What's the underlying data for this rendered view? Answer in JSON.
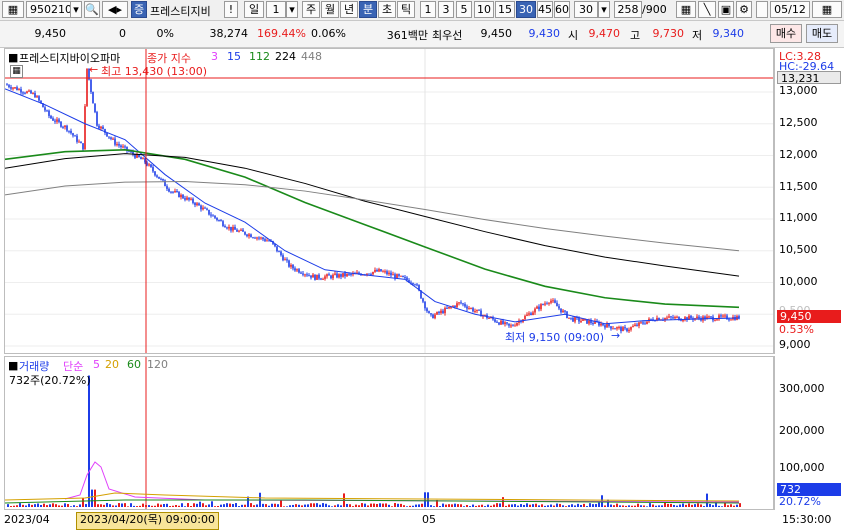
{
  "toolbar": {
    "code": "950210",
    "stock_name": "프레스티지비",
    "tag": "증",
    "warn": "!",
    "period": "일",
    "period_count": "1",
    "periods": [
      "주",
      "월",
      "년",
      "분",
      "초",
      "틱"
    ],
    "active_period": "분",
    "minutes": [
      "1",
      "3",
      "5",
      "10",
      "15",
      "30",
      "45",
      "60"
    ],
    "active_minute": "30",
    "count": "30",
    "page": "258",
    "page_total": "/900",
    "date": "05/12"
  },
  "quote": {
    "price": "9,450",
    "change": "0",
    "change_rate": "0%",
    "volume": "38,274",
    "volume_ratio": "169.44%",
    "turnover": "0.06%",
    "amount": "361백만",
    "best_bid_label": "최우선",
    "best_bid": "9,450",
    "best_ask": "9,430",
    "open_label": "시",
    "open": "9,470",
    "high_label": "고",
    "high": "9,730",
    "low_label": "저",
    "low": "9,340",
    "buy_label": "매수",
    "sell_label": "매도"
  },
  "price_panel": {
    "name": "프레스티지바이오파마",
    "ma_label": "종가 지수",
    "ma_periods": [
      "3",
      "15",
      "112",
      "224",
      "448"
    ],
    "lc": "LC:3.28",
    "hc": "HC:-29.64",
    "high_marker": "최고 13,430 (13:00)",
    "low_marker": "최저 9,150 (09:00)",
    "crosshair_price": "13,231",
    "last_price": "9,450",
    "last_change": "0.53%",
    "y_ticks": [
      "13,000",
      "12,500",
      "12,000",
      "11,500",
      "11,000",
      "10,500",
      "10,000",
      "9,500",
      "9,000"
    ]
  },
  "volume_panel": {
    "label": "거래량",
    "ma_label": "단순",
    "ma_periods": [
      "5",
      "20",
      "60",
      "120"
    ],
    "peak": "732주(20.72%)",
    "y_ticks": [
      "300,000",
      "200,000",
      "100,000"
    ],
    "last_volume": "732",
    "last_ratio": "20.72%"
  },
  "x_axis": {
    "start": "2023/04",
    "crosshair_date": "2023/04/20(목) 09:00:00",
    "month_mark": "05",
    "time": "15:30:00"
  },
  "colors": {
    "up": "#e81c1c",
    "down": "#1c3ce8",
    "ma3": "#1c3ce8",
    "ma15": "#1a8a1a",
    "ma112": "#1a8a1a",
    "ma224": "#000000",
    "ma448": "#808080",
    "accent": "#3a64b4"
  }
}
